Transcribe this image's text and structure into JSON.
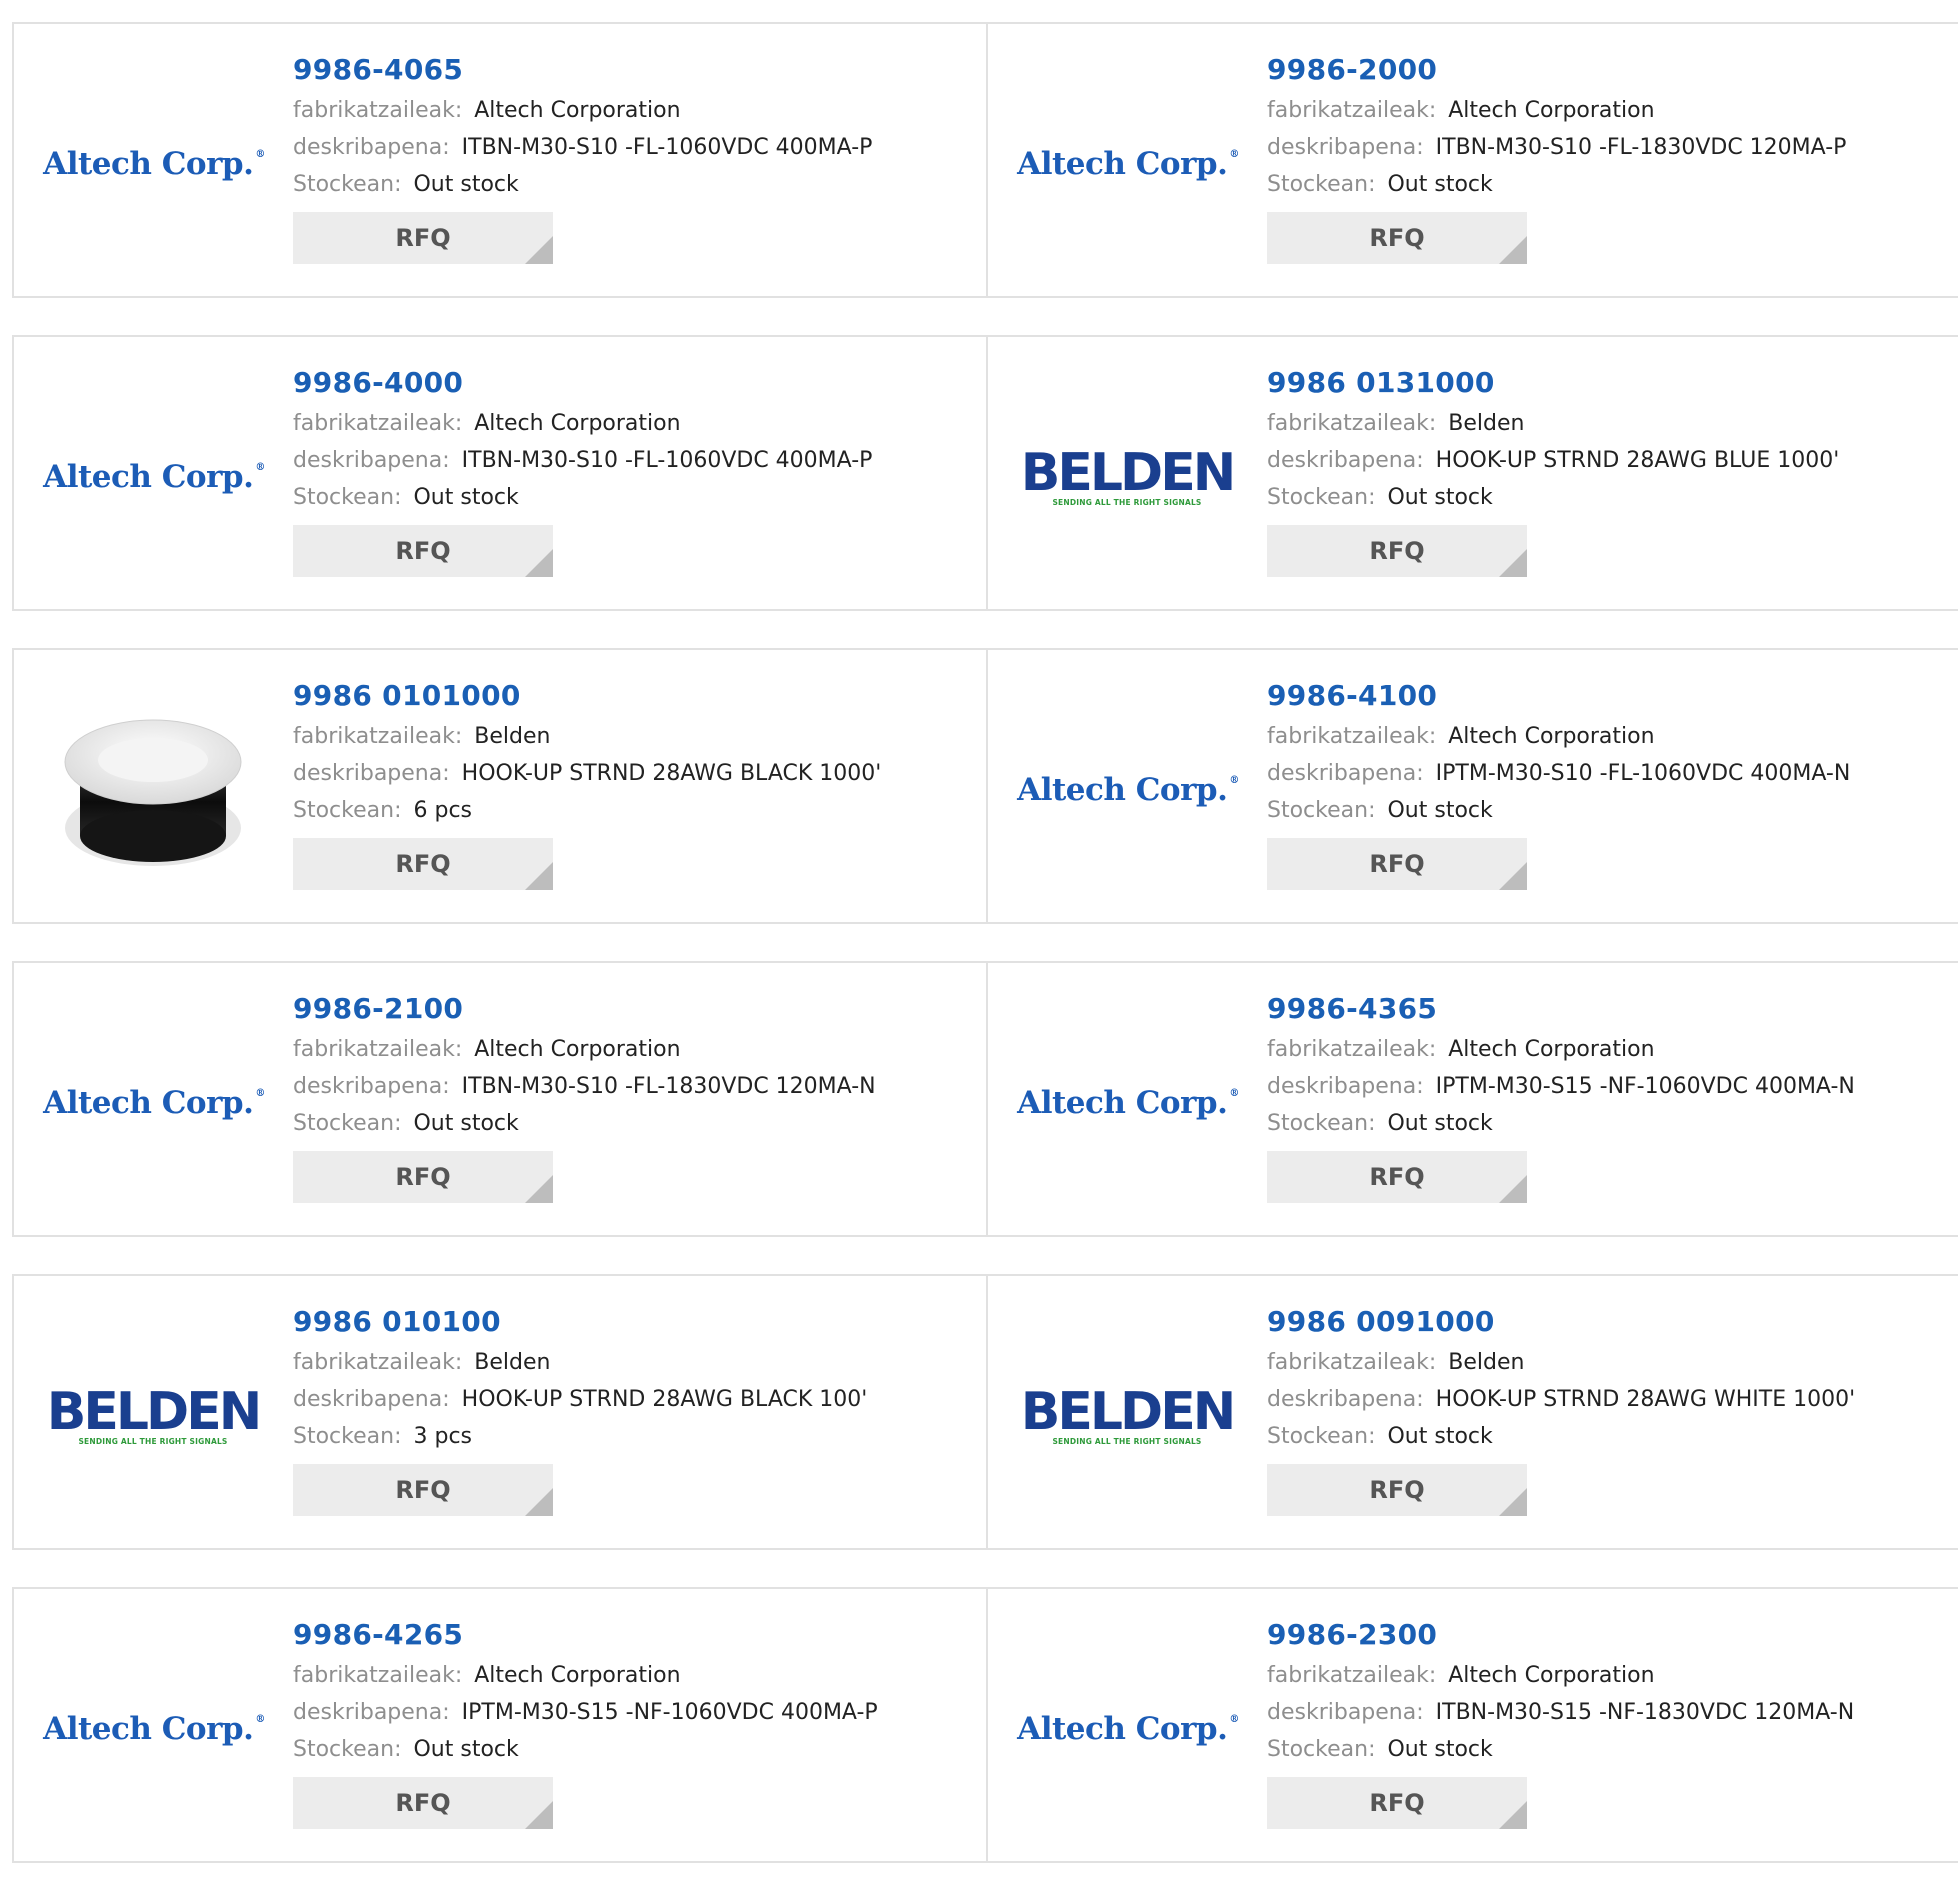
{
  "labels": {
    "manufacturer": "fabrikatzaileak:",
    "description": "deskribapena:",
    "stock": "Stockean:",
    "rfq": "RFQ"
  },
  "colors": {
    "part_link": "#1a5fb4",
    "label_gray": "#8e8e8e",
    "border": "#e1e1e1",
    "button_bg": "#ececec",
    "altech_blue": "#1c5cb6",
    "belden_blue": "#1a3f8f",
    "belden_green": "#2e9a3a"
  },
  "logos": {
    "altech": {
      "text": "Altech Corp.",
      "mark": "®"
    },
    "belden": {
      "text": "BELDEN",
      "tagline": "SENDING ALL THE RIGHT SIGNALS"
    }
  },
  "products": [
    {
      "part": "9986-4065",
      "manufacturer": "Altech Corporation",
      "description": "ITBN-M30-S10 -FL-1060VDC 400MA-P",
      "stock": "Out stock",
      "image": "altech-logo"
    },
    {
      "part": "9986-2000",
      "manufacturer": "Altech Corporation",
      "description": "ITBN-M30-S10 -FL-1830VDC 120MA-P",
      "stock": "Out stock",
      "image": "altech-logo"
    },
    {
      "part": "9986-4000",
      "manufacturer": "Altech Corporation",
      "description": "ITBN-M30-S10 -FL-1060VDC 400MA-P",
      "stock": "Out stock",
      "image": "altech-logo"
    },
    {
      "part": "9986 0131000",
      "manufacturer": "Belden",
      "description": "HOOK-UP STRND 28AWG BLUE 1000'",
      "stock": "Out stock",
      "image": "belden-logo"
    },
    {
      "part": "9986 0101000",
      "manufacturer": "Belden",
      "description": "HOOK-UP STRND 28AWG BLACK 1000'",
      "stock": "6 pcs",
      "image": "wire-spool-photo"
    },
    {
      "part": "9986-4100",
      "manufacturer": "Altech Corporation",
      "description": "IPTM-M30-S10 -FL-1060VDC 400MA-N",
      "stock": "Out stock",
      "image": "altech-logo"
    },
    {
      "part": "9986-2100",
      "manufacturer": "Altech Corporation",
      "description": "ITBN-M30-S10 -FL-1830VDC 120MA-N",
      "stock": "Out stock",
      "image": "altech-logo"
    },
    {
      "part": "9986-4365",
      "manufacturer": "Altech Corporation",
      "description": "IPTM-M30-S15 -NF-1060VDC 400MA-N",
      "stock": "Out stock",
      "image": "altech-logo"
    },
    {
      "part": "9986 010100",
      "manufacturer": "Belden",
      "description": "HOOK-UP STRND 28AWG BLACK 100'",
      "stock": "3 pcs",
      "image": "belden-logo"
    },
    {
      "part": "9986 0091000",
      "manufacturer": "Belden",
      "description": "HOOK-UP STRND 28AWG WHITE 1000'",
      "stock": "Out stock",
      "image": "belden-logo"
    },
    {
      "part": "9986-4265",
      "manufacturer": "Altech Corporation",
      "description": "IPTM-M30-S15 -NF-1060VDC 400MA-P",
      "stock": "Out stock",
      "image": "altech-logo"
    },
    {
      "part": "9986-2300",
      "manufacturer": "Altech Corporation",
      "description": "ITBN-M30-S15 -NF-1830VDC 120MA-N",
      "stock": "Out stock",
      "image": "altech-logo"
    }
  ]
}
